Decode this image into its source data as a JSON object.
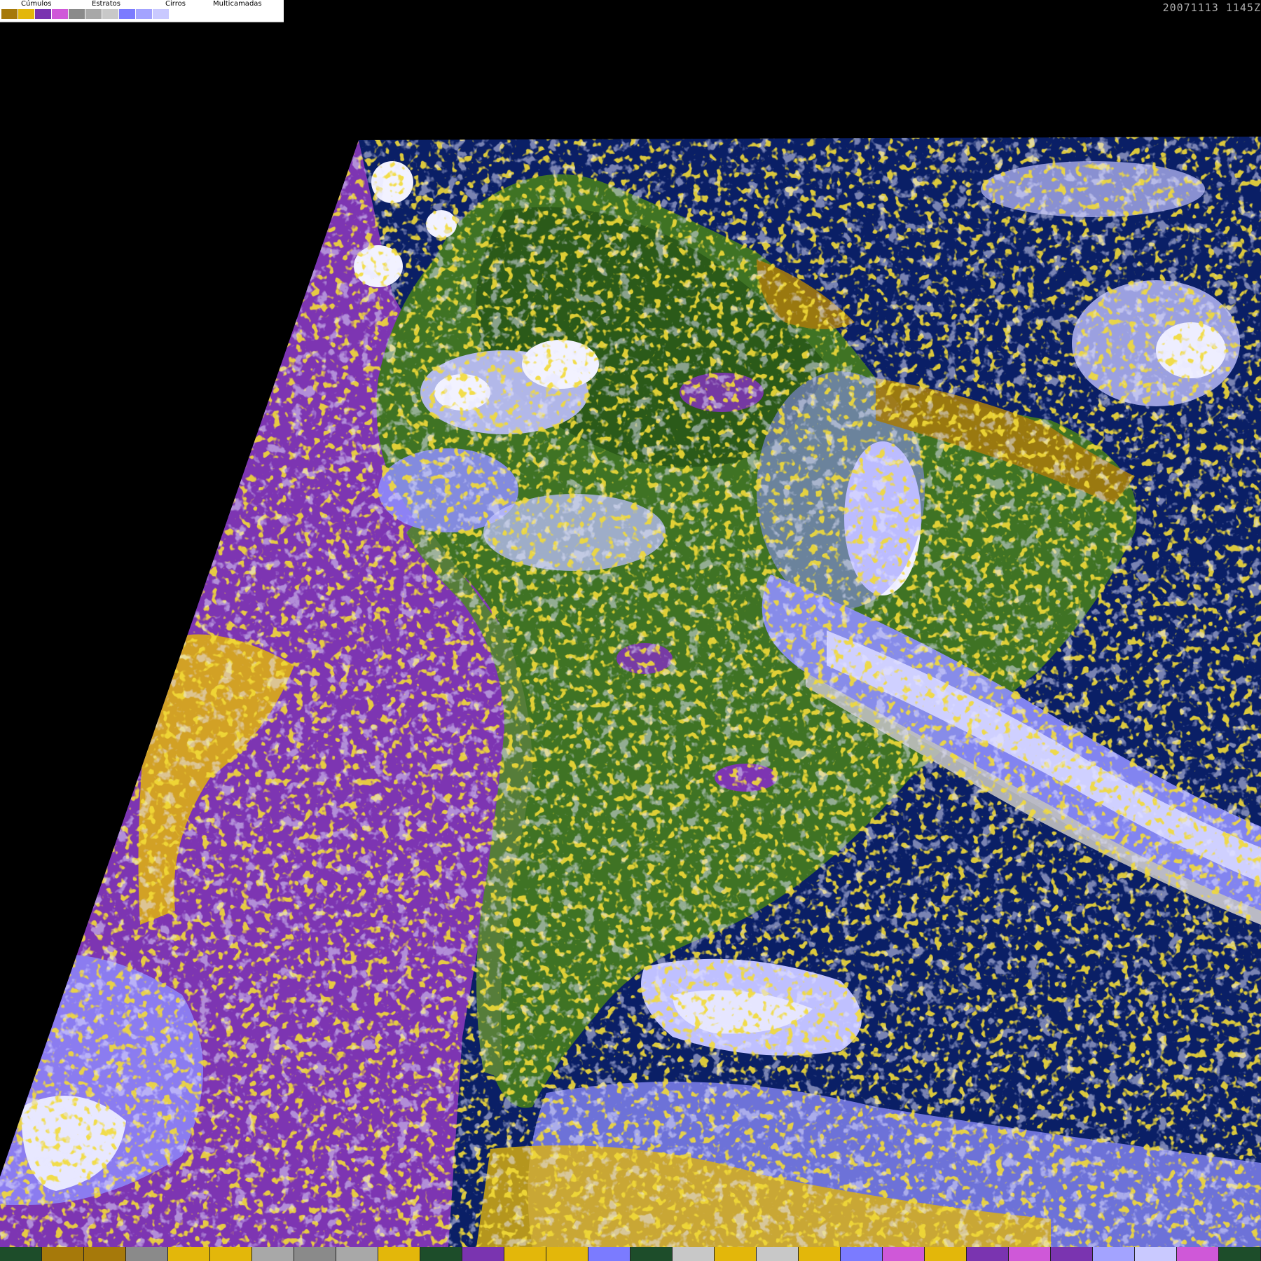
{
  "timestamp": "20071113 1145Z",
  "legend": {
    "categories": [
      {
        "label": "Cúmulos",
        "colors": [
          "#a6790a",
          "#e3b70a"
        ]
      },
      {
        "label": "Estratos",
        "colors": [
          "#7a34b0",
          "#cf58d8"
        ]
      },
      {
        "label": "Cirros",
        "colors": [
          "#8a8a8a",
          "#a8a8a8",
          "#c8c8c8"
        ]
      },
      {
        "label": "Multicamadas",
        "colors": [
          "#7b7bff",
          "#a3a3ff",
          "#c9c9ff",
          "#ffffff"
        ]
      }
    ]
  },
  "palette": {
    "ocean": "#0a1f66",
    "stratus_ocean": "#7d35b2",
    "land": "#3f7324",
    "land_dark": "#2b5a19",
    "cumulus": "#e0b40c",
    "cumulus_dark": "#a47a0e",
    "cirrus": "#c0c0c0",
    "multilayer": "#bfc0ff",
    "multilayer_mid": "#8f8fff",
    "white_cloud": "#f2f2ff"
  },
  "bottom_bar": [
    "#1d4d2a",
    "#a6790a",
    "#a6790a",
    "#8a8a8a",
    "#e3b70a",
    "#e3b70a",
    "#a8a8a8",
    "#8a8a8a",
    "#a8a8a8",
    "#e3b70a",
    "#1d4d2a",
    "#7a34b0",
    "#e3b70a",
    "#e3b70a",
    "#7b7bff",
    "#1d4d2a",
    "#c8c8c8",
    "#e3b70a",
    "#c8c8c8",
    "#e3b70a",
    "#7b7bff",
    "#cf58d8",
    "#e3b70a",
    "#7a34b0",
    "#cf58d8",
    "#7a34b0",
    "#a3a3ff",
    "#c9c9ff",
    "#cf58d8",
    "#1d4d2a"
  ]
}
